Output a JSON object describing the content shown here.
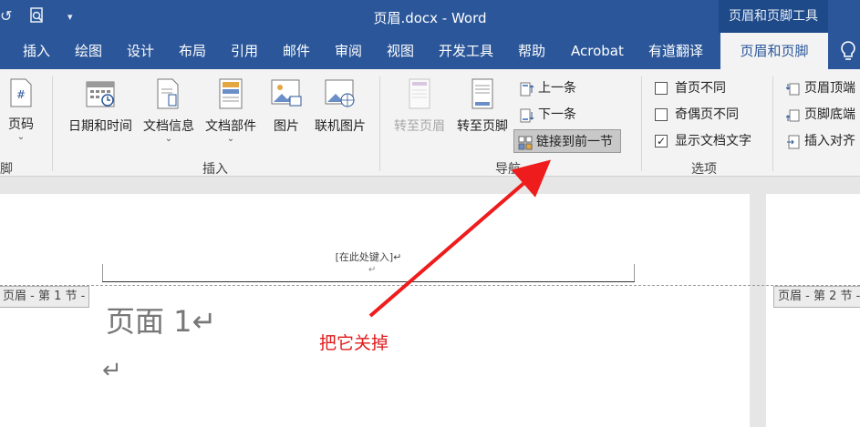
{
  "window": {
    "title": "页眉.docx - Word",
    "context_title": "页眉和页脚工具"
  },
  "tabs": [
    "插入",
    "绘图",
    "设计",
    "布局",
    "引用",
    "邮件",
    "审阅",
    "视图",
    "开发工具",
    "帮助",
    "Acrobat",
    "有道翻译",
    "页眉和页脚"
  ],
  "active_tab": "页眉和页脚",
  "ribbon": {
    "page_number": "页码",
    "left_group_label_fragment": "脚",
    "insert_group": {
      "label": "插入",
      "buttons": [
        "日期和时间",
        "文档信息",
        "文档部件",
        "图片",
        "联机图片"
      ]
    },
    "nav_group": {
      "label": "导航",
      "goto_header": "转至页眉",
      "goto_footer": "转至页脚",
      "previous": "上一条",
      "next": "下一条",
      "link_previous": "链接到前一节"
    },
    "options_group": {
      "label": "选项",
      "diff_first": "首页不同",
      "diff_odd_even": "奇偶页不同",
      "show_text": "显示文档文字",
      "show_text_checked": true
    },
    "position_group": {
      "header_top": "页眉顶端",
      "footer_bottom": "页脚底端",
      "insert_align": "插入对齐"
    }
  },
  "document": {
    "header_placeholder": "[在此处键入]↵",
    "header_mark": "↵",
    "section1_tag": "页眉 - 第 1 节 -",
    "section2_tag": "页眉 - 第 2 节 -",
    "body_line1": "页面 1↵",
    "body_line2": "↵"
  },
  "annotation": {
    "text": "把它关掉",
    "color": "#e21b1b"
  },
  "colors": {
    "titlebar": "#2b579a",
    "ribbon": "#f3f3f3"
  }
}
